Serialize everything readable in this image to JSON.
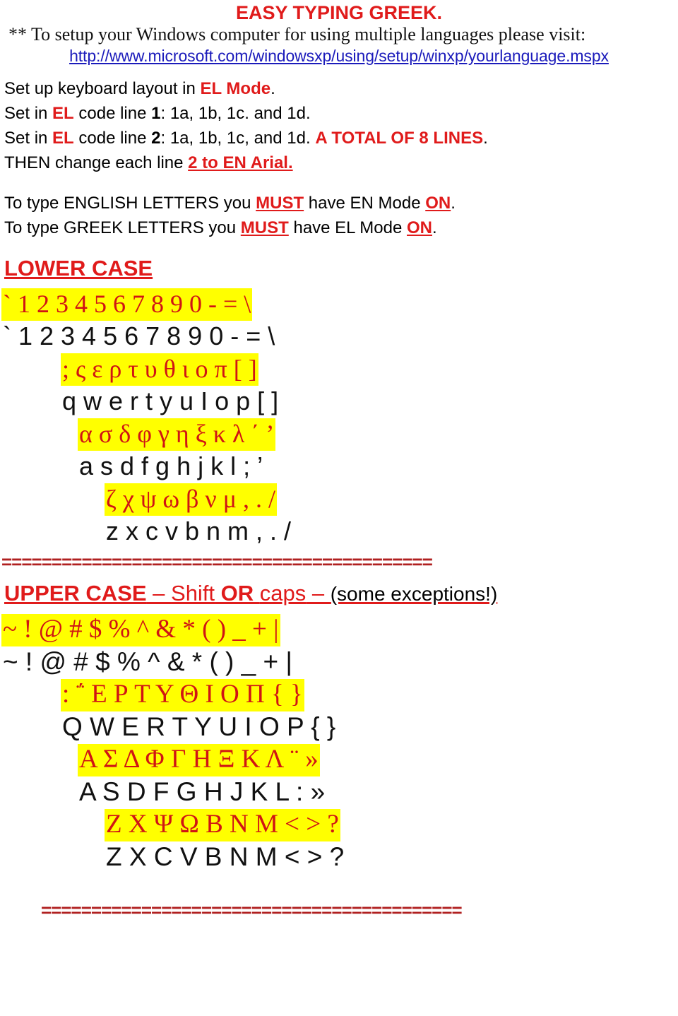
{
  "header": {
    "title": "EASY TYPING GREEK.",
    "setup_note_prefix": "** To setup your Windows computer for using multiple languages please visit:",
    "url": "http://www.microsoft.com/windowsxp/using/setup/winxp/yourlanguage.mspx"
  },
  "instructions": {
    "line1": {
      "a": "Set up keyboard layout in ",
      "b": "EL Mode",
      "c": "."
    },
    "line2": {
      "a": "Set in ",
      "b": "EL",
      "c": " code line ",
      "d": "1",
      "e": ": 1a, 1b, 1c. and 1d."
    },
    "line3": {
      "a": "Set in ",
      "b": "EL",
      "c": " code line ",
      "d": "2",
      "e": ": 1a, 1b, 1c, and 1d. ",
      "f": "A TOTAL OF 8 LINES",
      "g": "."
    },
    "line4": {
      "a": "THEN change each line ",
      "b": "2 to EN Arial."
    },
    "line5": {
      "a": "To type ENGLISH LETTERS you ",
      "b": "MUST",
      "c": " have EN Mode ",
      "d": "ON",
      "e": "."
    },
    "line6": {
      "a": "To type GREEK LETTERS you ",
      "b": "MUST",
      "c": " have EL Mode ",
      "d": "ON",
      "e": "."
    }
  },
  "sections": {
    "lower_case_heading": "LOWER CASE",
    "upper_case_heading": {
      "part1": "UPPER CASE",
      "dash1": " – ",
      "part2": "Shift",
      "part3": " OR ",
      "part4": "caps",
      "dash2": " – ",
      "part5": "(some exceptions!)"
    }
  },
  "separators": {
    "top": "===========================================",
    "bottom": "=========================================="
  },
  "lower_case": {
    "rows": [
      {
        "indent": "ind0",
        "greek": "`  1  2  3  4   5  6   7  8   9  0  -   =  \\",
        "english": "`  1  2  3  4   5  6   7  8   9  0  -   =  \\"
      },
      {
        "indent": "ind1",
        "greek": ";  ς  ε  ρ  τ  υ  θ  ι  ο  π  [   ]",
        "english": "q  w  e  r   t   y   u   I   o   p   [   ]"
      },
      {
        "indent": "ind2",
        "greek": "α  σ  δ  φ  γ  η  ξ  κ λ   ΄   ’",
        "english": "a  s  d  f   g   h   j   k  l    ;    ’"
      },
      {
        "indent": "ind3",
        "greek": "ζ  χ  ψ  ω  β  ν  μ   ,   .   /",
        "english": "z  x  c  v  b  n  m   ,   .   /"
      }
    ]
  },
  "upper_case": {
    "rows": [
      {
        "indent": "ind0",
        "greek": "~  !   @   #  $   %  ^  &  *  ( )  _   +   |",
        "english": "~  !   @   #  $   %  ^  &  *  ( )  _   +   |"
      },
      {
        "indent": "ind1",
        "greek": ":     ΅   Ε  Ρ   Τ  Υ  Θ  Ι  Ο Π { }",
        "english": "Q   W  E   R    T   Y   U  I   O  P  { }"
      },
      {
        "indent": "ind2",
        "greek": "Α   Σ   Δ    Φ    Γ  Η  Ξ Κ  Λ   ¨  »",
        "english": "A   S   D   F    G  H  J  K  L   :  »"
      },
      {
        "indent": "ind3",
        "greek": "Ζ   Χ   Ψ   Ω   Β  Ν  Μ  <  >  ?",
        "english": "Z   X   C   V   B  N  M  <  >  ?"
      }
    ]
  },
  "colors": {
    "red": "#e01b1b",
    "greek_red": "#d01414",
    "highlight_yellow": "#ffff00",
    "link_blue": "#1b1bbb",
    "separator_red": "#b02020"
  }
}
